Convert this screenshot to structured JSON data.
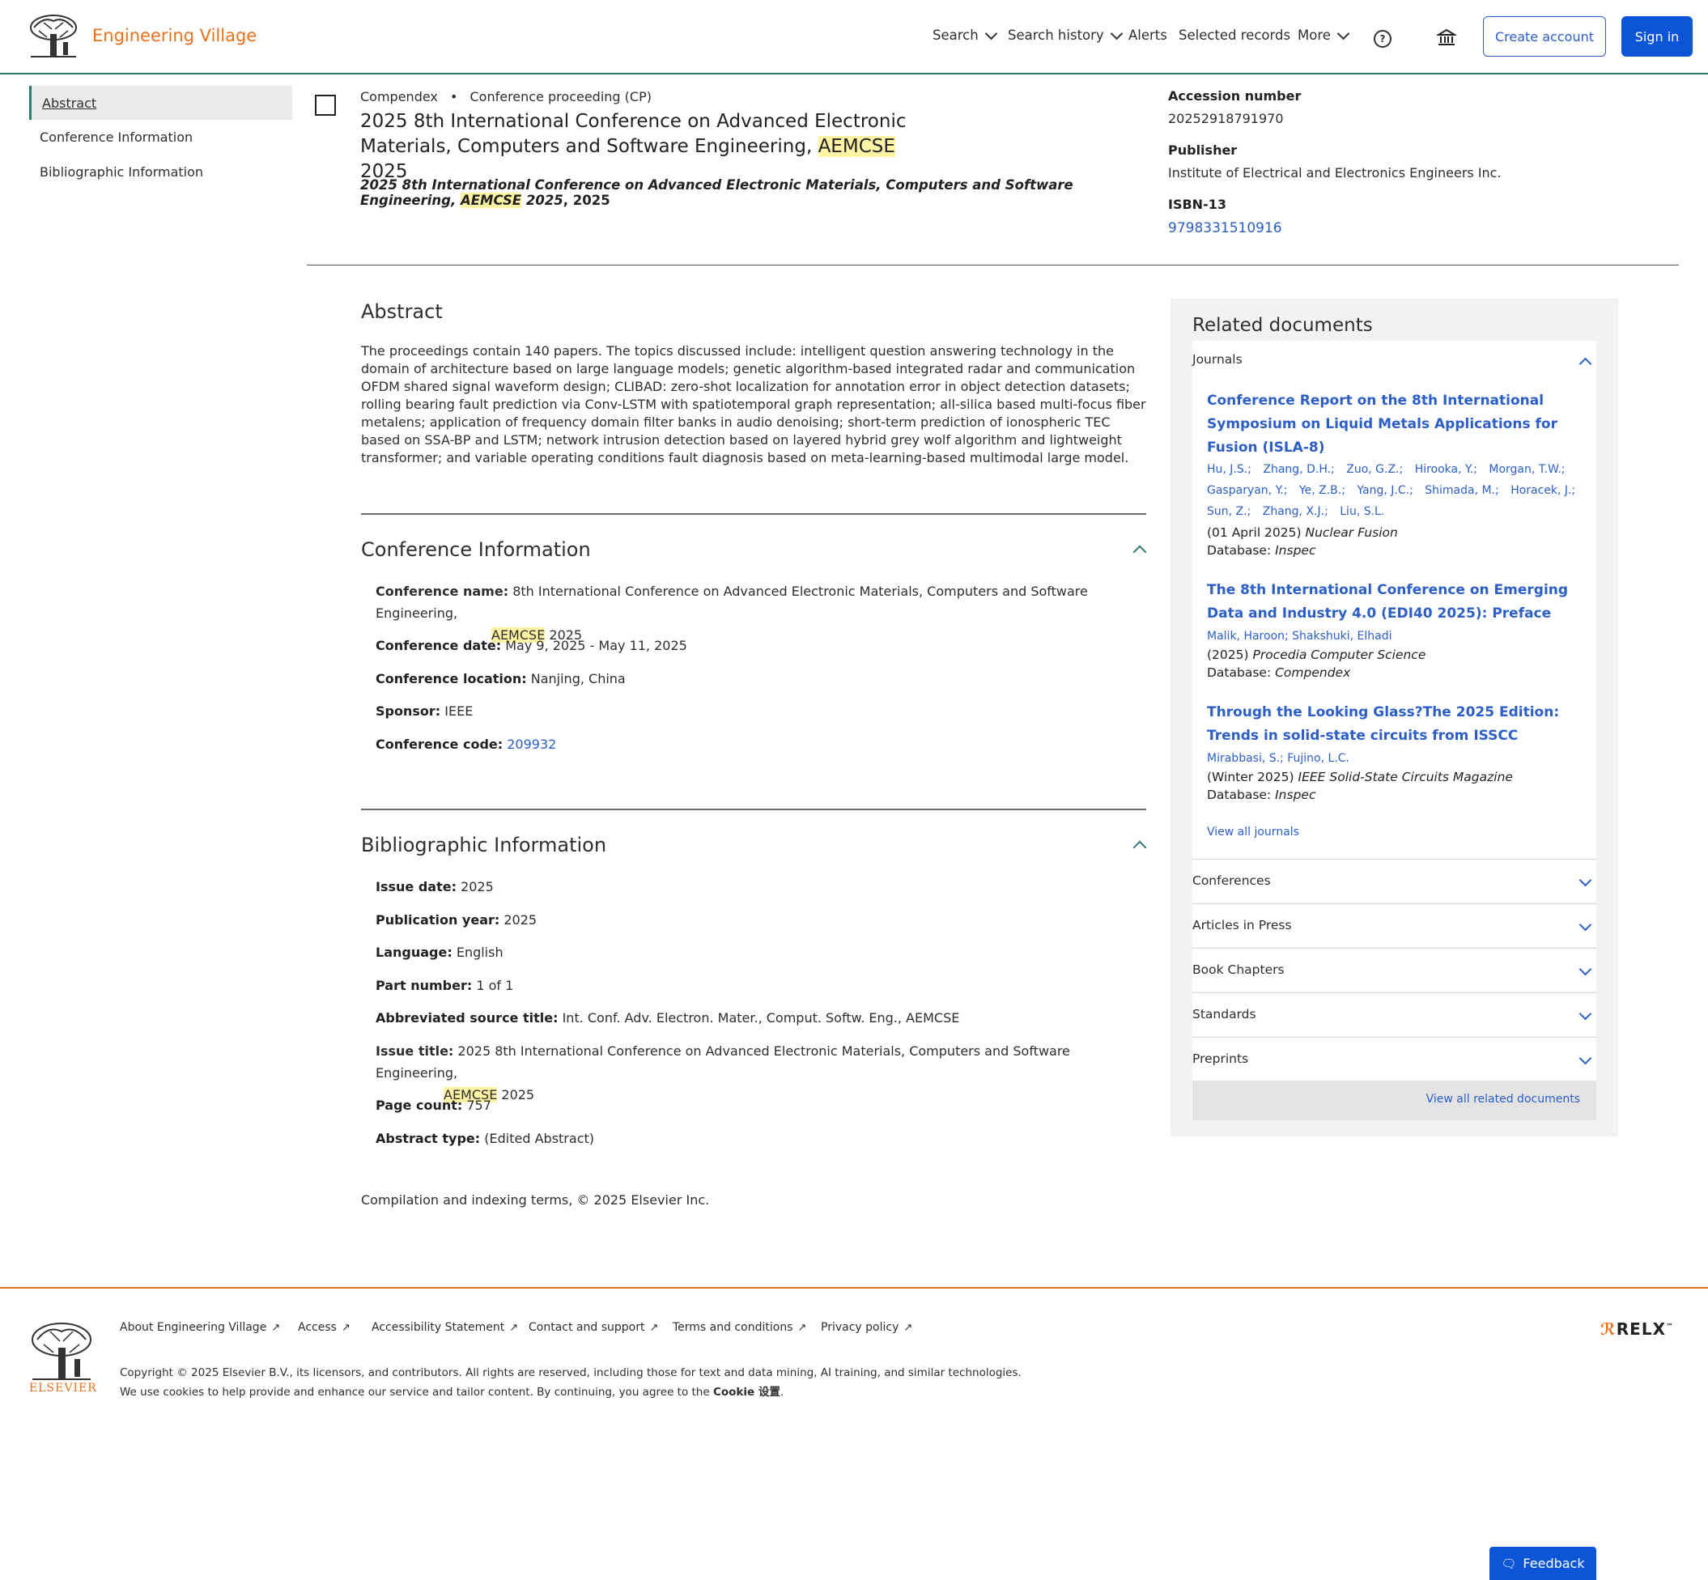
{
  "header": {
    "brand": "Engineering Village",
    "nav": {
      "search": "Search",
      "search_history": "Search history",
      "alerts": "Alerts",
      "selected_records": "Selected records",
      "more": "More"
    },
    "create_account": "Create account",
    "sign_in": "Sign in"
  },
  "left_nav": {
    "abstract": "Abstract",
    "conference": "Conference Information",
    "bibliographic": "Bibliographic Information"
  },
  "record": {
    "database": "Compendex",
    "doc_type": "Conference proceeding (CP)",
    "title_pre": "2025 8th International Conference on Advanced Electronic Materials, Computers and Software Engineering, ",
    "title_hl": "AEMCSE",
    "title_post": " 2025",
    "subtitle_pre": "2025 8th International Conference on Advanced Electronic Materials, Computers and Software Engineering, ",
    "subtitle_hl": "AEMCSE",
    "subtitle_post": " 2025",
    "subtitle_year": ", 2025",
    "accession_label": "Accession number",
    "accession_value": "20252918791970",
    "publisher_label": "Publisher",
    "publisher_value": "Institute of Electrical and Electronics Engineers Inc.",
    "isbn_label": "ISBN-13",
    "isbn_value": "9798331510916"
  },
  "abstract": {
    "heading": "Abstract",
    "text": "The proceedings contain 140 papers. The topics discussed include: intelligent question answering technology in the domain of architecture based on large language models; genetic algorithm-based integrated radar and communication OFDM shared signal waveform design; CLIBAD: zero-shot localization for annotation error in object detection datasets; rolling bearing fault prediction via Conv-LSTM with spatiotemporal graph representation; all-silica based multi-focus fiber metalens; application of frequency domain filter banks in audio denoising; short-term prediction of ionospheric TEC based on SSA-BP and LSTM; network intrusion detection based on layered hybrid grey wolf algorithm and lightweight transformer; and variable operating conditions fault diagnosis based on meta-learning-based multimodal large model."
  },
  "conference": {
    "heading": "Conference Information",
    "name_label": "Conference name:",
    "name_value_pre": "8th International Conference on Advanced Electronic Materials, Computers and Software Engineering,",
    "name_value_hl": "AEMCSE",
    "name_value_post": " 2025",
    "date_label": "Conference date:",
    "date_value": "May 9, 2025 - May 11, 2025",
    "location_label": "Conference location:",
    "location_value": "Nanjing, China",
    "sponsor_label": "Sponsor:",
    "sponsor_value": "IEEE",
    "code_label": "Conference code:",
    "code_value": "209932"
  },
  "bibliographic": {
    "heading": "Bibliographic Information",
    "issue_date_label": "Issue date:",
    "issue_date_value": "2025",
    "pub_year_label": "Publication year:",
    "pub_year_value": "2025",
    "language_label": "Language:",
    "language_value": "English",
    "part_label": "Part number:",
    "part_value": "1 of 1",
    "abbrev_label": "Abbreviated source title:",
    "abbrev_value": "Int. Conf. Adv. Electron. Mater., Comput. Softw. Eng., AEMCSE",
    "issue_title_label": "Issue title:",
    "issue_title_pre": "2025 8th International Conference on Advanced Electronic Materials, Computers and Software Engineering,",
    "issue_title_hl": "AEMCSE",
    "issue_title_post": " 2025",
    "page_count_label": "Page count:",
    "page_count_value": "757",
    "abstract_type_label": "Abstract type:",
    "abstract_type_value": "(Edited Abstract)"
  },
  "compilation": "Compilation and indexing terms, © 2025 Elsevier Inc.",
  "related": {
    "heading": "Related documents",
    "journals_label": "Journals",
    "items": [
      {
        "title": "Conference Report on the 8th International Symposium on Liquid Metals Applications for Fusion (ISLA-8)",
        "authors": [
          "Hu, J.S.;",
          "Zhang, D.H.;",
          "Zuo, G.Z.;",
          "Hirooka, Y.;",
          "Morgan, T.W.;",
          "Gasparyan, Y.;",
          "Ye, Z.B.;",
          "Yang, J.C.;",
          "Shimada, M.;",
          "Horacek, J.;",
          "Sun, Z.;",
          "Zhang, X.J.;",
          "Liu, S.L."
        ],
        "date": "(01 April 2025) ",
        "source": "Nuclear Fusion",
        "db_label": "Database: ",
        "db": "Inspec"
      },
      {
        "title": "The 8th International Conference on Emerging Data and Industry 4.0 (EDI40 2025): Preface",
        "authors": [
          "Malik, Haroon; Shakshuki, Elhadi"
        ],
        "date": "(2025) ",
        "source": "Procedia Computer Science",
        "db_label": "Database: ",
        "db": "Compendex"
      },
      {
        "title": "Through the Looking Glass?The 2025 Edition: Trends in solid-state circuits from ISSCC",
        "authors": [
          "Mirabbasi, S.; Fujino, L.C."
        ],
        "date": "(Winter 2025) ",
        "source": "IEEE Solid-State Circuits Magazine",
        "db_label": "Database: ",
        "db": "Inspec"
      }
    ],
    "view_all_journals": "View all journals",
    "accordions": [
      "Conferences",
      "Articles in Press",
      "Book Chapters",
      "Standards",
      "Preprints"
    ],
    "view_all_related": "View all related documents"
  },
  "footer": {
    "elsevier": "ELSEVIER",
    "links": [
      "About Engineering Village",
      "Access",
      "Accessibility Statement",
      "Contact and support",
      "Terms and conditions",
      "Privacy policy"
    ],
    "copyright": "Copyright © 2025 Elsevier B.V., its licensors, and contributors. All rights are reserved, including those for text and data mining, AI training, and similar technologies.",
    "cookie_pre": "We use cookies to help provide and enhance our service and tailor content. By continuing, you agree to the ",
    "cookie_link": "Cookie 设置",
    "cookie_post": ".",
    "relx": "RELX",
    "feedback": "Feedback"
  },
  "colors": {
    "accent_orange": "#e9711c",
    "primary_blue": "#0c55d6",
    "link_blue": "#2c5ec8",
    "highlight": "#fff3a6",
    "teal": "#2d7a6d"
  }
}
